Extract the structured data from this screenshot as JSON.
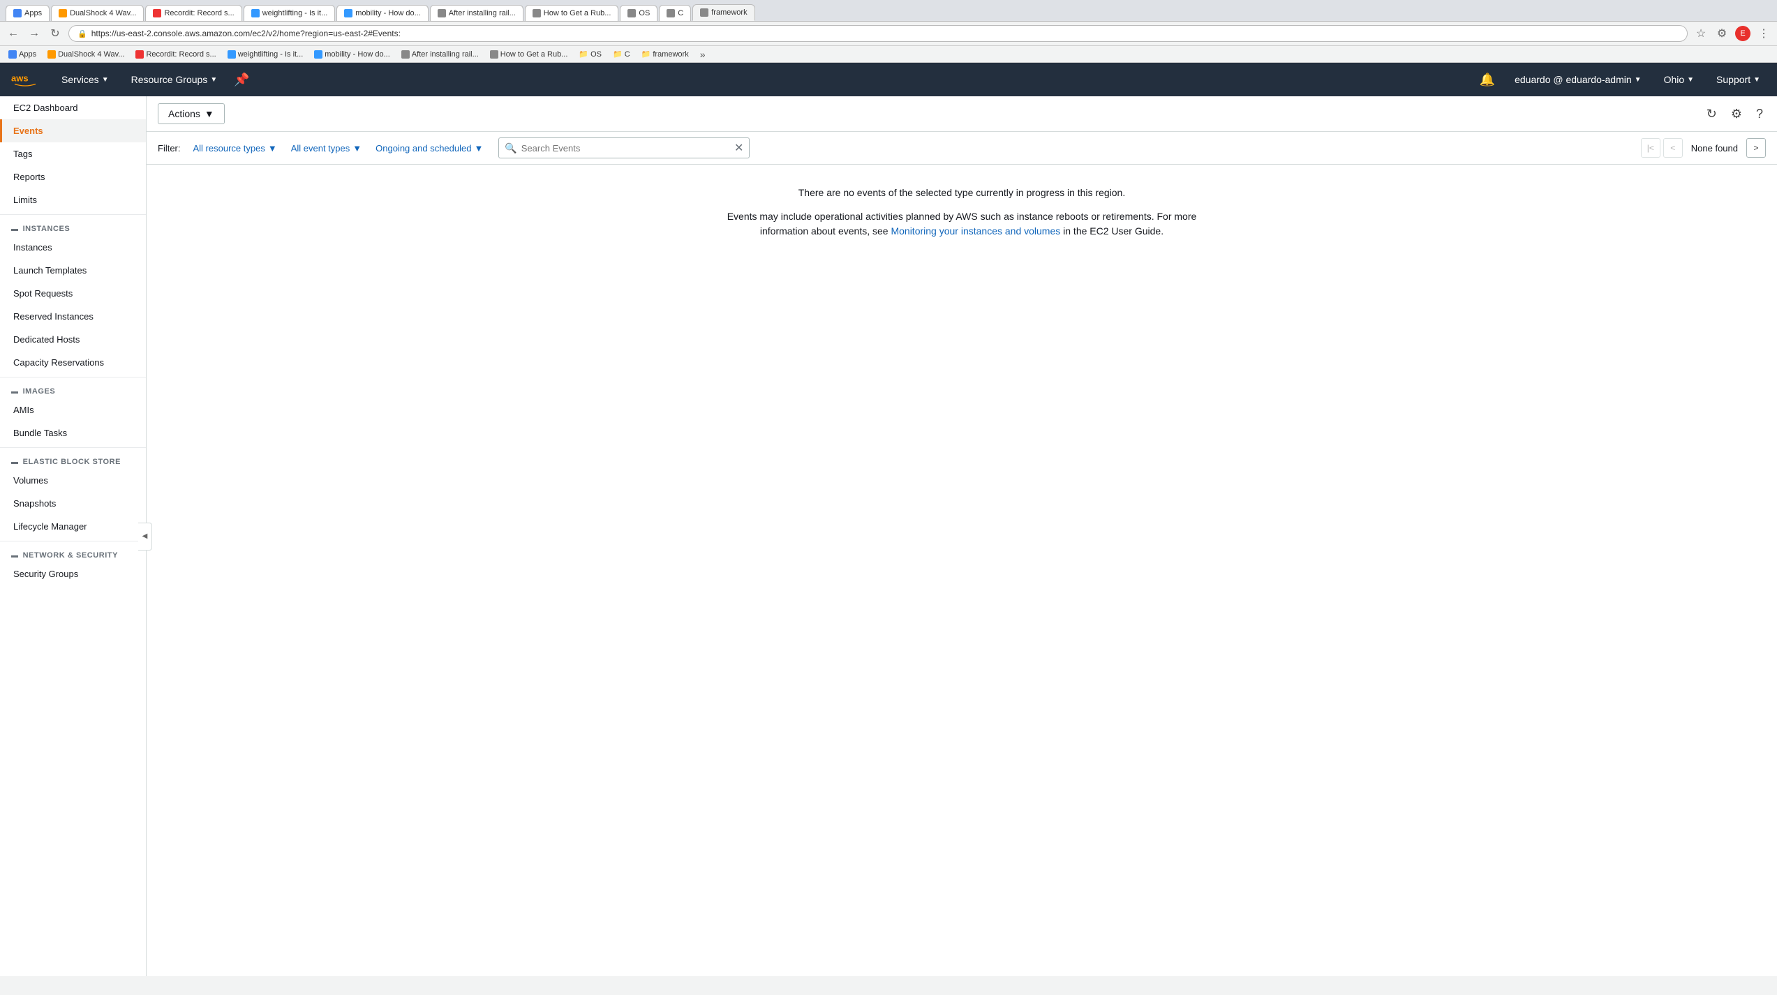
{
  "browser": {
    "tabs": [
      {
        "label": "Apps",
        "icon": "grid",
        "active": false
      },
      {
        "label": "DualShock 4 Wav...",
        "icon": "amazon",
        "active": false
      },
      {
        "label": "Recordit: Record s...",
        "icon": "rec",
        "active": false
      },
      {
        "label": "weightlifting - Is it...",
        "icon": "pf",
        "active": false
      },
      {
        "label": "mobility - How do...",
        "icon": "pf",
        "active": false
      },
      {
        "label": "After installing rail...",
        "icon": "doc",
        "active": false
      },
      {
        "label": "How to Get a Rub...",
        "icon": "doc",
        "active": false
      },
      {
        "label": "OS",
        "icon": "folder",
        "active": false
      },
      {
        "label": "C",
        "icon": "folder",
        "active": false
      },
      {
        "label": "framework",
        "icon": "folder",
        "active": true
      }
    ],
    "address": "https://us-east-2.console.aws.amazon.com/ec2/v2/home?region=us-east-2#Events:",
    "bookmarks": [
      {
        "label": "Apps",
        "icon": "grid"
      },
      {
        "label": "DualShock 4 Wav...",
        "icon": "amazon"
      },
      {
        "label": "Recordit: Record s...",
        "icon": "rec"
      },
      {
        "label": "weightlifting - Is it...",
        "icon": "pf"
      },
      {
        "label": "mobility - How do...",
        "icon": "pf"
      },
      {
        "label": "After installing rail...",
        "icon": "doc"
      },
      {
        "label": "How to Get a Rub...",
        "icon": "doc"
      },
      {
        "label": "OS",
        "icon": "folder"
      },
      {
        "label": "C",
        "icon": "folder"
      },
      {
        "label": "framework",
        "icon": "folder"
      }
    ]
  },
  "navbar": {
    "services_label": "Services",
    "resource_groups_label": "Resource Groups",
    "user_label": "eduardo @ eduardo-admin",
    "region_label": "Ohio",
    "support_label": "Support"
  },
  "sidebar": {
    "dashboard_label": "EC2 Dashboard",
    "events_label": "Events",
    "tags_label": "Tags",
    "reports_label": "Reports",
    "limits_label": "Limits",
    "sections": [
      {
        "name": "INSTANCES",
        "items": [
          "Instances",
          "Launch Templates",
          "Spot Requests",
          "Reserved Instances",
          "Dedicated Hosts",
          "Capacity Reservations"
        ]
      },
      {
        "name": "IMAGES",
        "items": [
          "AMIs",
          "Bundle Tasks"
        ]
      },
      {
        "name": "ELASTIC BLOCK STORE",
        "items": [
          "Volumes",
          "Snapshots",
          "Lifecycle Manager"
        ]
      },
      {
        "name": "NETWORK & SECURITY",
        "items": [
          "Security Groups"
        ]
      }
    ]
  },
  "toolbar": {
    "actions_label": "Actions"
  },
  "filter": {
    "label": "Filter:",
    "resource_types_label": "All resource types",
    "event_types_label": "All event types",
    "schedule_label": "Ongoing and scheduled",
    "search_placeholder": "Search Events",
    "none_found": "None found"
  },
  "content": {
    "no_events_msg": "There are no events of the selected type currently in progress in this region.",
    "events_info_before": "Events may include operational activities planned by AWS such as instance reboots or retirements. For more information about events, see ",
    "events_link_text": "Monitoring your instances and volumes",
    "events_info_after": " in the EC2 User Guide."
  }
}
